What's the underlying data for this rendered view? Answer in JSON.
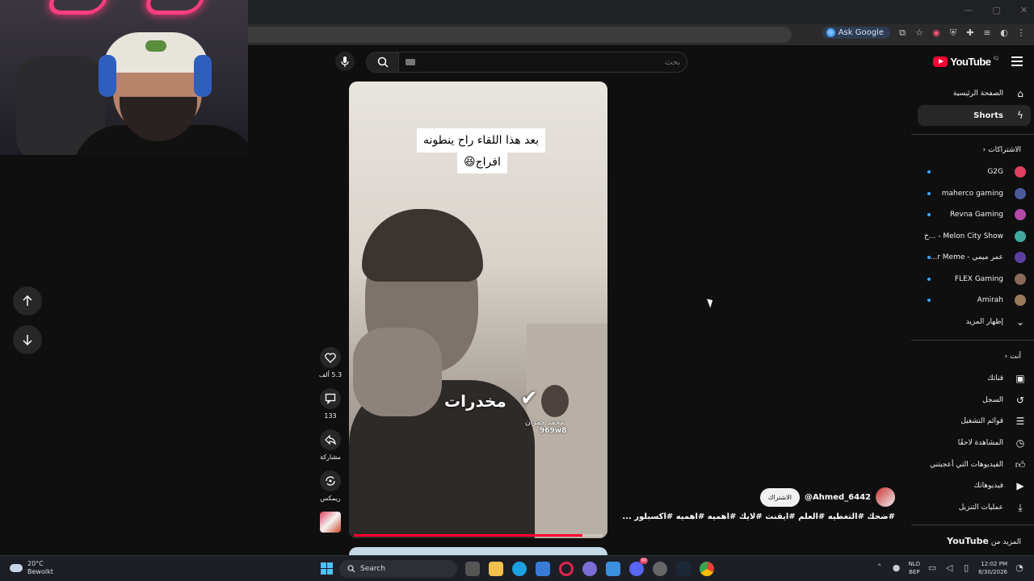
{
  "browser": {
    "ask_google_label": "Ask Google"
  },
  "search": {
    "placeholder": "بحث"
  },
  "brand": {
    "name": "YouTube",
    "region": "IQ"
  },
  "short": {
    "caption_line1": "بعد هذا اللقاء راح ينطونه",
    "caption_line2": "افراج😆",
    "stamp_text": "مخدرات",
    "stamp_name": "محمد جمران",
    "stamp_id": "969w8",
    "progress": 0.92
  },
  "actions": {
    "likes": "5.3 ألف",
    "comments": "133",
    "share": "مشاركة",
    "remix": "ريمكس"
  },
  "channel": {
    "handle": "@Ahmed_6442",
    "subscribe_label": "الاشتراك",
    "hashtags": "#ضحك #التغطيه #العلم #ايقنت #لايك #اهميه #اهميه #اكسبلور ..."
  },
  "sidebar": {
    "home": "الصفحة الرئيسية",
    "shorts": "Shorts",
    "subscriptions_header": "الاشتراكات",
    "channels": [
      {
        "name": "G2G",
        "color": "#e0405f"
      },
      {
        "name": "maherco gaming",
        "color": "#4a5a9a"
      },
      {
        "name": "Revna Gaming",
        "color": "#b34aa8"
      },
      {
        "name": "Melon City Show - ...خ",
        "color": "#3fa9a0"
      },
      {
        "name": "عمر ميمي - r Meme...",
        "color": "#5b3fa0"
      },
      {
        "name": "FLEX Gaming",
        "color": "#8a6a5a"
      },
      {
        "name": "Amirah",
        "color": "#9a7a5a"
      }
    ],
    "show_more": "إظهار المزيد",
    "you_header": "أنت",
    "you_items": [
      "قناتك",
      "السجل",
      "قوائم التشغيل",
      "المشاهدة لاحقًا",
      "الفيديوهات التي أعجبتني",
      "فيديوهاتك",
      "عمليات التنزيل"
    ],
    "more_from": "المزيد من",
    "more_from_brand": "YouTube"
  },
  "taskbar": {
    "temp": "20°C",
    "weather": "Bewolkt",
    "search_label": "Search",
    "lang1": "NLD",
    "lang2": "BEP",
    "time": "12:02 PM",
    "date": "8/30/2026",
    "badge": "99"
  },
  "colors": {
    "accent": "#ff0033",
    "dot": "#3ea6ff"
  }
}
